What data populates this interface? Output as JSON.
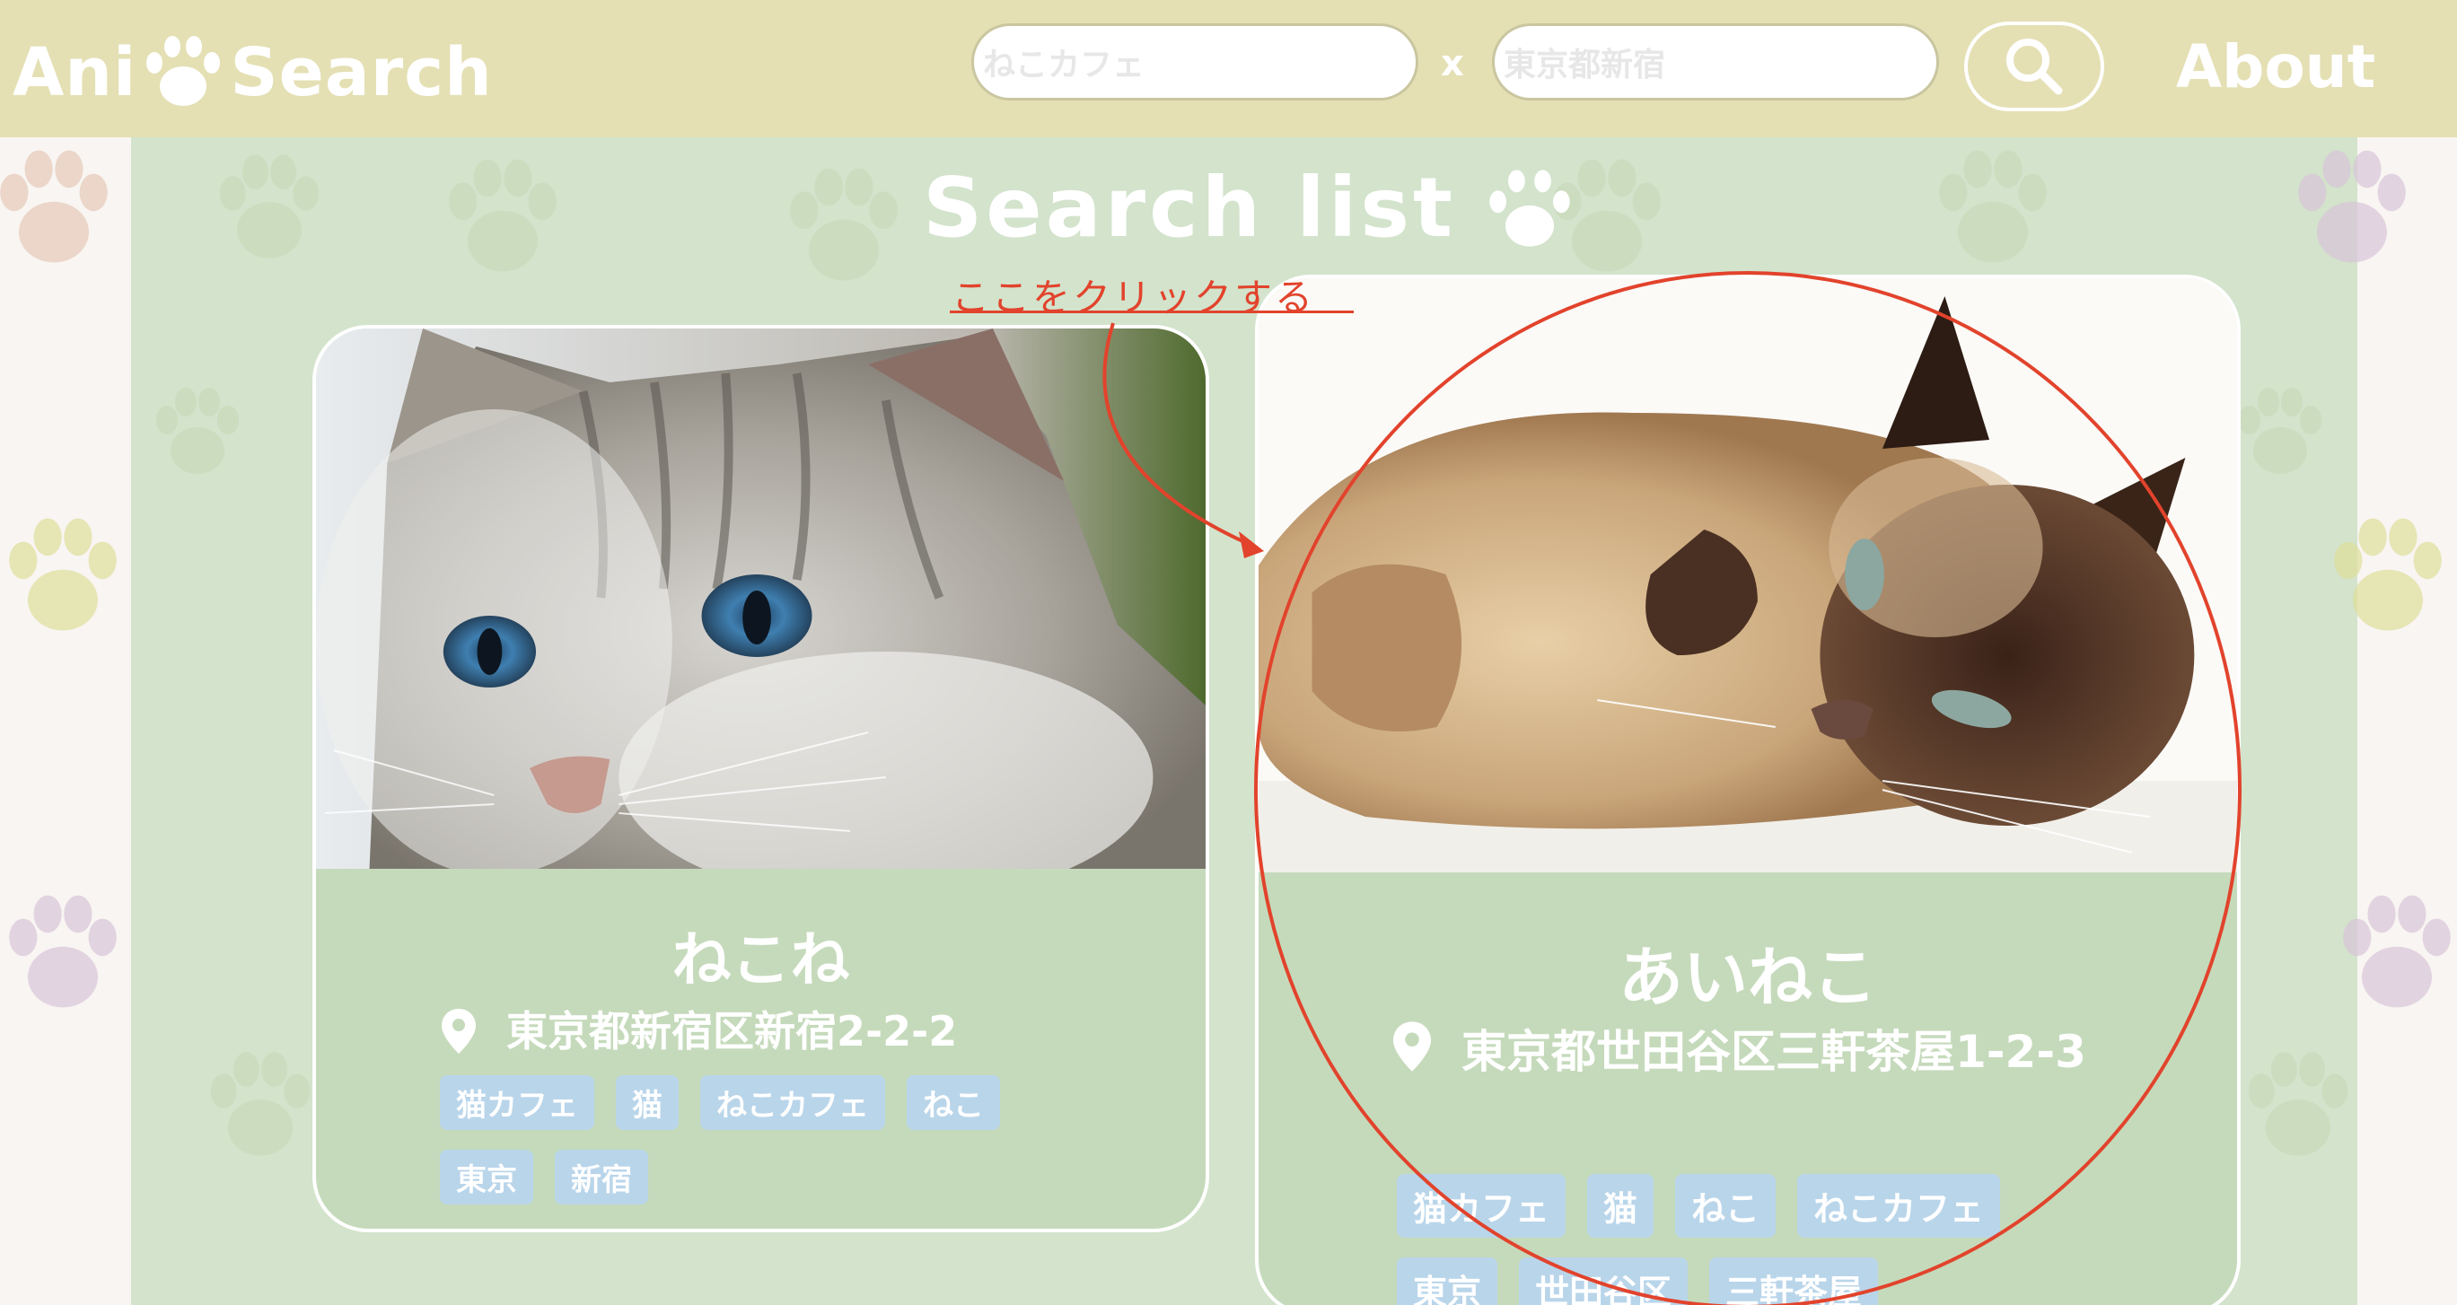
{
  "header": {
    "logo_part1": "Ani",
    "logo_part2": "Search",
    "search_placeholder_1": "ねこカフェ",
    "search_placeholder_2": "東京都新宿",
    "separator": "x",
    "about_label": "About"
  },
  "main": {
    "title": "Search list"
  },
  "annotation": {
    "text": "ここをクリックする",
    "color": "#e2432c"
  },
  "cards": [
    {
      "name": "ねこね",
      "address": "東京都新宿区新宿2-2-2",
      "tags": [
        "猫カフェ",
        "猫",
        "ねこカフェ",
        "ねこ",
        "東京",
        "新宿"
      ]
    },
    {
      "name": "あいねこ",
      "address": "東京都世田谷区三軒茶屋1-2-3",
      "tags": [
        "猫カフェ",
        "猫",
        "ねこ",
        "ねこカフェ",
        "東京",
        "世田谷区",
        "三軒茶屋"
      ]
    }
  ],
  "colors": {
    "header_bg": "#e4e0b4",
    "panel_bg": "#d3e3cc",
    "card_bg": "#c5dabb",
    "tag_bg": "#b9d5ea"
  }
}
